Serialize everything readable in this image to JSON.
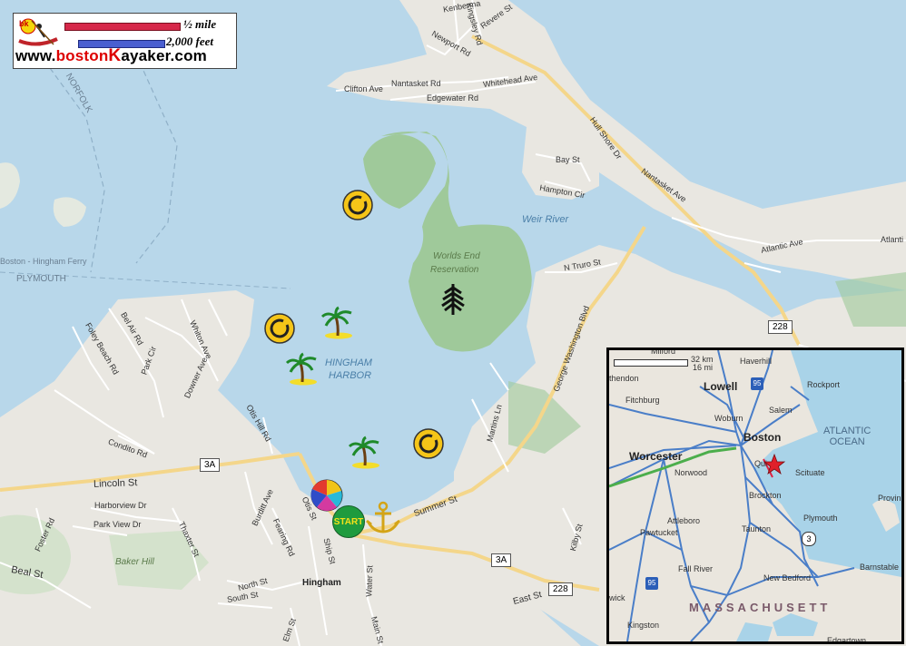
{
  "legend": {
    "scale_miles": "½ mile",
    "scale_feet": "2,000 feet",
    "site_prefix": "www.",
    "site_boston": "boston",
    "site_k": "K",
    "site_rest": "ayaker.com",
    "logo_badge": "bk",
    "mile_bar_color": "#d6284a",
    "feet_bar_color": "#4a5fd0"
  },
  "colors": {
    "water": "#b8d7ea",
    "land": "#e9e7e1",
    "park": "#9fc99a",
    "road_major": "#f4d68a",
    "road_minor": "#ffffff"
  },
  "labels": {
    "norfolk": "NORFOLK",
    "plymouth": "PLYMOUTH",
    "ferry": "Boston - Hingham Ferry",
    "worlds_end_1": "Worlds End",
    "worlds_end_2": "Reservation",
    "weir_river": "Weir River",
    "hingham_harbor_1": "HINGHAM",
    "hingham_harbor_2": "HARBOR",
    "baker_hill": "Baker Hill",
    "hingham": "Hingham"
  },
  "streets": {
    "clifton_ave": "Clifton Ave",
    "nantasket_rd": "Nantasket Rd",
    "edgewater_rd": "Edgewater Rd",
    "whitehead_ave": "Whitehead Ave",
    "newport_rd": "Newport Rd",
    "kingsley_rd": "Kingsley Rd",
    "revere_st": "Revere St",
    "kenberma": "Kenberma",
    "hull_shore_dr": "Hull Shore Dr",
    "nantasket_ave": "Nantasket Ave",
    "bay_st": "Bay St",
    "hampton_cir": "Hampton Cir",
    "atlantic_ave": "Atlantic Ave",
    "atlantic_ave2": "Atlanti",
    "n_truro_st": "N Truro St",
    "george_washington_blvd": "George Washington Blvd",
    "martins_ln": "Martins Ln",
    "summer_st": "Summer St",
    "kilby_st": "Kilby St",
    "east_st": "East St",
    "otis_st": "Otis St",
    "otis_hill_rd": "Otis Hill Rd",
    "ship_st": "Ship St",
    "water_st": "Water St",
    "main_st": "Main St",
    "north_st": "North St",
    "south_st": "South St",
    "elm_st": "Elm St",
    "burditt_ave": "Burditt Ave",
    "fearing_rd": "Fearing Rd",
    "lincoln_st": "Lincoln St",
    "harborview_dr": "Harborview Dr",
    "park_view_dr": "Park View Dr",
    "thaxter_st": "Thaxter St",
    "condito_rd": "Condito Rd",
    "foster_rd": "Foster Rd",
    "beal_st": "Beal St",
    "bel_air_rd": "Bel Air Rd",
    "foley_beach_rd": "Foley Beach Rd",
    "park_cir": "Park Cir",
    "whiton_ave": "Whiton Ave",
    "downer_ave": "Downer Ave"
  },
  "shields": {
    "r228_top": "228",
    "r3a_left": "3A",
    "r3a_bottom": "3A",
    "r228_bottom": "228"
  },
  "markers": {
    "start": "START",
    "icons": [
      "mooring-icon",
      "palm-tree-icon",
      "beach-ball-icon",
      "anchor-icon",
      "tree-icon",
      "start-icon"
    ]
  },
  "inset": {
    "scale_km": "32 km",
    "scale_mi": "16 mi",
    "cities": {
      "haverhill": "Haverhill",
      "lowell": "Lowell",
      "rockport": "Rockport",
      "salem": "Salem",
      "boston": "Boston",
      "fitchburg": "Fitchburg",
      "woburn": "Woburn",
      "worcester": "Worcester",
      "norwood": "Norwood",
      "quincy": "Qui",
      "scituate": "Scituate",
      "brockton": "Brockton",
      "plymouth": "Plymouth",
      "attleboro": "Attleboro",
      "taunton": "Taunton",
      "pawtucket": "Pawtucket",
      "fall_river": "Fall River",
      "new_bedford": "New Bedford",
      "barnstable": "Barnstable",
      "provincetown": "Provin",
      "kingston": "Kingston",
      "edgartown": "Edgartown",
      "warwick": "wick",
      "methuen": "thendon",
      "milford": "Milford"
    },
    "ocean_1": "ATLANTIC",
    "ocean_2": "OCEAN",
    "state": "MASSACHUSETT",
    "i95_north": "95",
    "i95_south": "95",
    "route3": "3"
  }
}
